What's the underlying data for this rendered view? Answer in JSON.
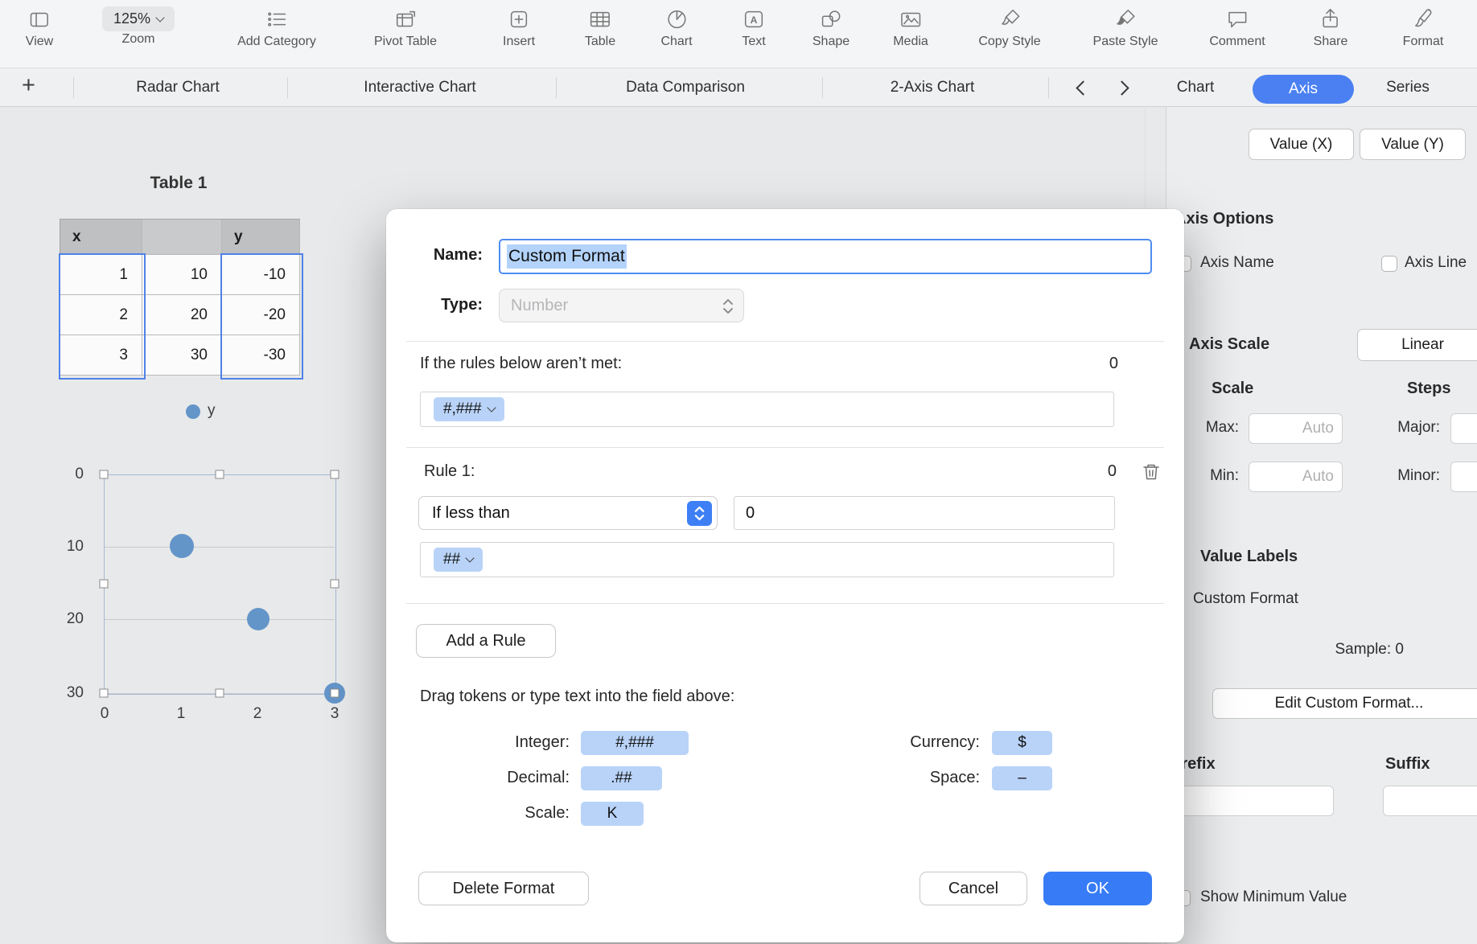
{
  "toolbar": {
    "items": [
      {
        "label": "View"
      },
      {
        "label": "Zoom",
        "value": "125%"
      },
      {
        "label": "Add Category"
      },
      {
        "label": "Pivot Table"
      },
      {
        "label": "Insert"
      },
      {
        "label": "Table"
      },
      {
        "label": "Chart"
      },
      {
        "label": "Text"
      },
      {
        "label": "Shape"
      },
      {
        "label": "Media"
      },
      {
        "label": "Copy Style"
      },
      {
        "label": "Paste Style"
      },
      {
        "label": "Comment"
      },
      {
        "label": "Share"
      },
      {
        "label": "Format"
      }
    ]
  },
  "tabbar": {
    "add_label": "+",
    "sheet_tabs": [
      "Radar Chart",
      "Interactive Chart",
      "Data Comparison",
      "2-Axis Chart"
    ],
    "inspector_tabs": [
      {
        "label": "Chart",
        "active": false
      },
      {
        "label": "Axis",
        "active": true
      },
      {
        "label": "Series",
        "active": false
      }
    ]
  },
  "canvas": {
    "table_title": "Table 1",
    "table": {
      "header": [
        "x",
        "",
        "y"
      ],
      "rows": [
        [
          "1",
          "10",
          "-10"
        ],
        [
          "2",
          "20",
          "-20"
        ],
        [
          "3",
          "30",
          "-30"
        ]
      ]
    },
    "legend_label": "y"
  },
  "chart_data": {
    "type": "scatter",
    "series": [
      {
        "name": "y",
        "points": [
          [
            1,
            10
          ],
          [
            2,
            20
          ],
          [
            3,
            30
          ]
        ]
      }
    ],
    "x_ticks": [
      "0",
      "1",
      "2",
      "3"
    ],
    "y_ticks": [
      "0",
      "10",
      "20",
      "30"
    ],
    "x_range": [
      0,
      3
    ],
    "y_range": [
      0,
      30
    ],
    "y_axis_inverted": true,
    "grid": true,
    "legend_position": "top"
  },
  "sidebar": {
    "value_axis_tabs": [
      "Value (X)",
      "Value (Y)"
    ],
    "axis_options_title": "Axis Options",
    "axis_name_label": "Axis Name",
    "axis_line_label": "Axis Line",
    "axis_scale_label": "Axis Scale",
    "axis_scale_value": "Linear",
    "scale_header": "Scale",
    "steps_header": "Steps",
    "max_label": "Max:",
    "max_value": "Auto",
    "min_label": "Min:",
    "min_value": "Auto",
    "major_label": "Major:",
    "minor_label": "Minor:",
    "value_labels_title": "Value Labels",
    "value_labels_value": "Custom Format",
    "sample_label": "Sample: 0",
    "edit_button": "Edit Custom Format...",
    "prefix_label": "Prefix",
    "suffix_label": "Suffix",
    "show_min_label": "Show Minimum Value"
  },
  "dialog": {
    "name_label": "Name:",
    "name_value": "Custom Format",
    "type_label": "Type:",
    "type_value": "Number",
    "rules_intro": "If the rules below aren’t met:",
    "rules_intro_value": "0",
    "default_token": "#,###",
    "rule1": {
      "label": "Rule 1:",
      "value": "0",
      "condition": "If less than",
      "condition_value": "0",
      "token": "##"
    },
    "add_rule_label": "Add a Rule",
    "drag_hint": "Drag tokens or type text into the field above:",
    "tokens": [
      {
        "label": "Integer:",
        "token": "#,###"
      },
      {
        "label": "Decimal:",
        "token": ".##"
      },
      {
        "label": "Scale:",
        "token": "K"
      },
      {
        "label": "Currency:",
        "token": "$"
      },
      {
        "label": "Space:",
        "token": "–"
      }
    ],
    "delete_label": "Delete Format",
    "cancel_label": "Cancel",
    "ok_label": "OK"
  },
  "colors": {
    "accent_blue": "#4a80f2",
    "ok_blue": "#377cf6",
    "token_blue": "#b9d3f8",
    "selection_blue": "#b3d3fb",
    "chart_dot_blue": "#6495c9"
  }
}
